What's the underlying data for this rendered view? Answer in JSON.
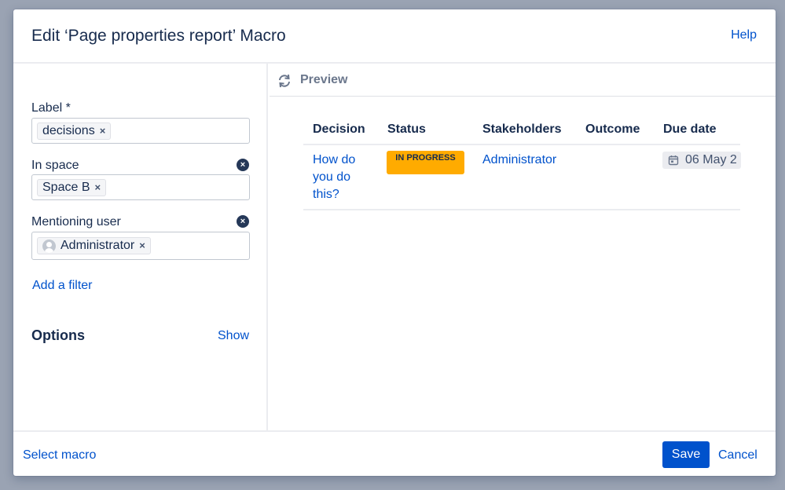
{
  "dialog": {
    "title": "Edit ‘Page properties report’ Macro",
    "help": "Help"
  },
  "form": {
    "label_field": {
      "label": "Label *",
      "chips": [
        "decisions"
      ]
    },
    "space_field": {
      "label": "In space",
      "chips": [
        "Space B"
      ]
    },
    "user_field": {
      "label": "Mentioning user",
      "chips": [
        "Administrator"
      ]
    },
    "add_filter": "Add a filter",
    "options": {
      "title": "Options",
      "toggle": "Show"
    },
    "chip_remove": "×",
    "clear_glyph": "×"
  },
  "preview": {
    "label": "Preview",
    "columns": [
      "Decision",
      "Status",
      "Stakeholders",
      "Outcome",
      "Due date"
    ],
    "rows": [
      {
        "decision_lines": [
          "How do",
          "you do",
          "this?"
        ],
        "status": "IN PROGRESS",
        "stakeholders": "Administrator",
        "outcome": "",
        "due_date": "06 May 2"
      }
    ]
  },
  "footer": {
    "select_macro": "Select macro",
    "save": "Save",
    "cancel": "Cancel"
  },
  "colors": {
    "backdrop": "#9aa3b3",
    "link": "#0052cc",
    "primary_button": "#0052cc",
    "status_in_progress": "#ffab00",
    "text": "#172b4d"
  },
  "icons": {
    "refresh": "refresh-icon",
    "calendar": "calendar-icon",
    "avatar": "user-avatar-icon",
    "clear": "clear-icon"
  }
}
